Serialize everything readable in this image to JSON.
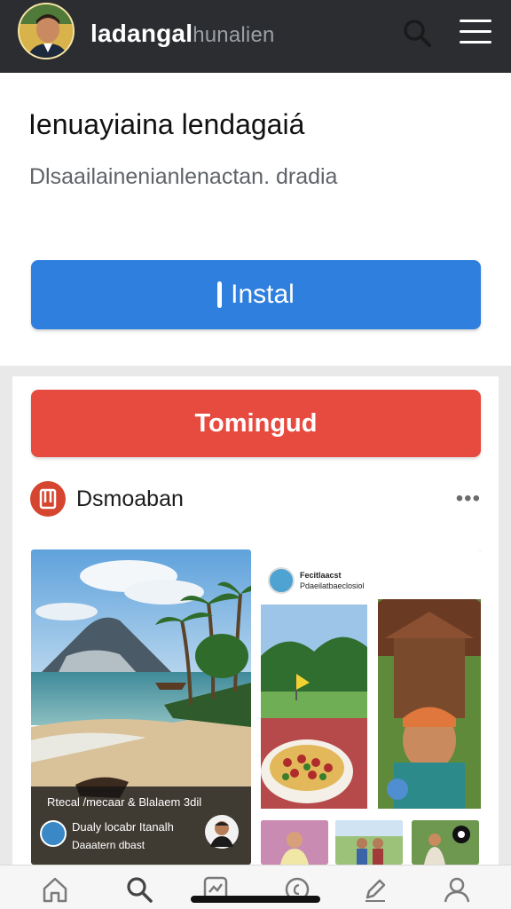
{
  "header": {
    "app_name": "ladangal",
    "app_name_suffix": "hunalien",
    "avatar_icon": "user-avatar",
    "search_icon": "search-icon",
    "menu_icon": "hamburger-menu-icon"
  },
  "install_section": {
    "title": "Ienuayiaina lendagaiá",
    "description": "Dlsaailainenianlenactan. dradia",
    "install_label": "Instal"
  },
  "feed": {
    "follow_label": "Tomingud",
    "post_author": "Dsmoaban",
    "more_label": "•••",
    "main_photo": {
      "caption_line1": "Rtecal /mecaar & Blalaem 3dil",
      "caption_line2": "Dualy locabr Itanalh",
      "caption_line3": "Daaatern dbast"
    },
    "collage": {
      "title": "Fecitlaacst",
      "subtitle": "Pdaeilatbaeclosiol"
    }
  },
  "bottom_nav": [
    {
      "icon": "home-icon"
    },
    {
      "icon": "search-icon"
    },
    {
      "icon": "activity-icon"
    },
    {
      "icon": "compass-icon"
    },
    {
      "icon": "edit-icon"
    },
    {
      "icon": "profile-icon"
    }
  ],
  "colors": {
    "topbar": "#2b2d30",
    "install_button": "#2f7fde",
    "follow_button": "#e74a3e",
    "post_icon": "#d6452f"
  }
}
